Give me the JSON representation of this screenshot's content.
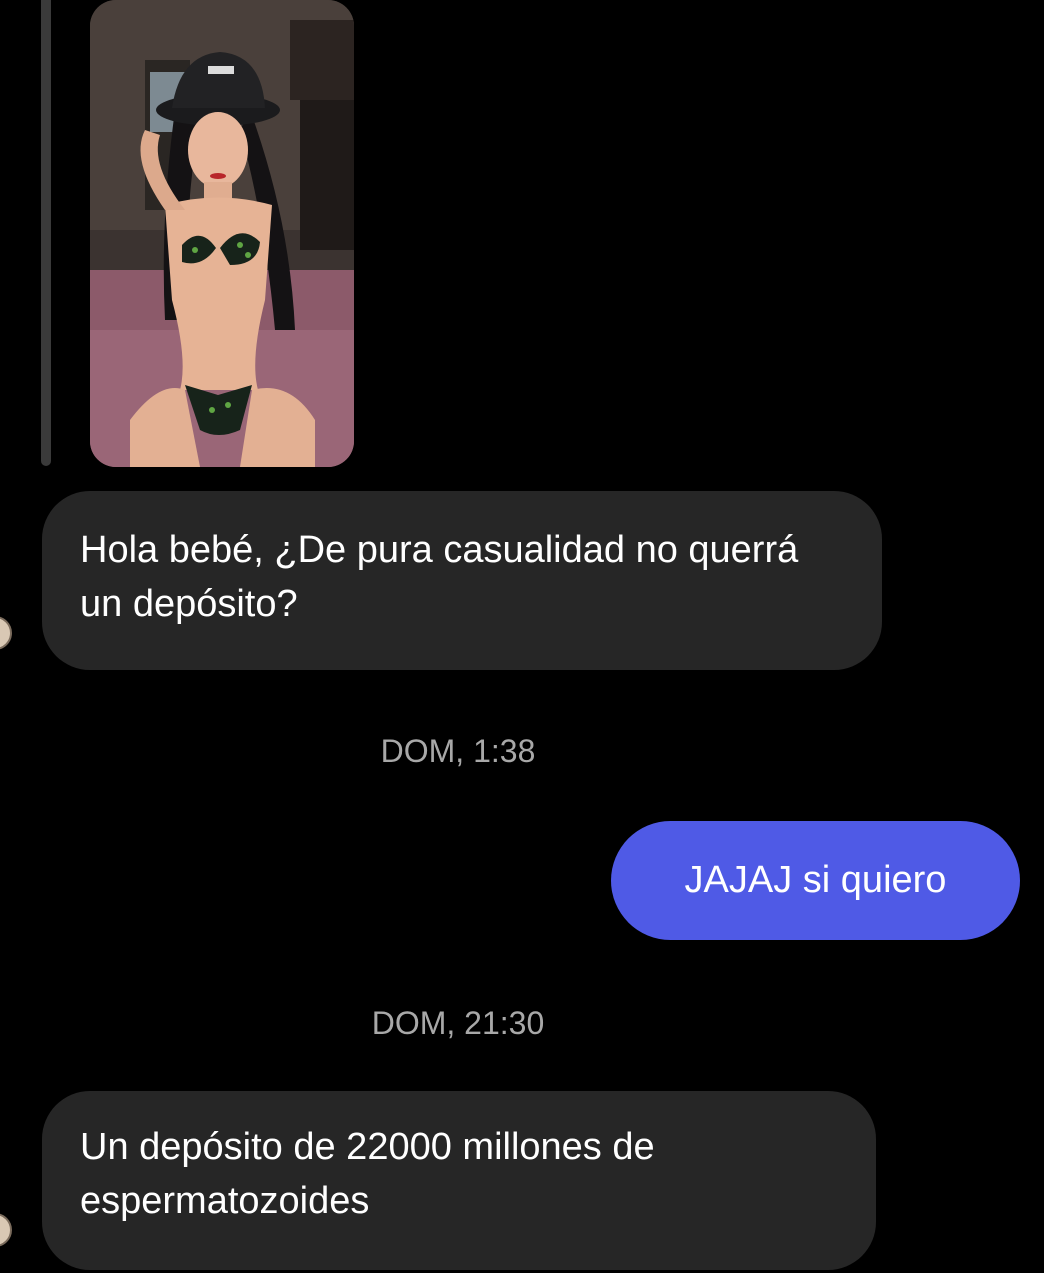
{
  "thread": {
    "messages": [
      {
        "sender": "them",
        "type": "image",
        "image_description": "photo of a woman wearing a black bucket hat"
      },
      {
        "sender": "them",
        "type": "text",
        "text": "Hola bebé, ¿De pura casualidad no querrá un depósito?"
      },
      {
        "sender": "timestamp",
        "text": "DOM, 1:38"
      },
      {
        "sender": "me",
        "type": "text",
        "text": "JAJAJ si quiero"
      },
      {
        "sender": "timestamp",
        "text": "DOM, 21:30"
      },
      {
        "sender": "them",
        "type": "text",
        "text": "Un depósito de 22000 millones de espermatozoides"
      }
    ]
  },
  "colors": {
    "background": "#000000",
    "received_bubble": "#262626",
    "sent_bubble": "#4f5ae6",
    "timestamp_text": "#a8a8a8"
  }
}
